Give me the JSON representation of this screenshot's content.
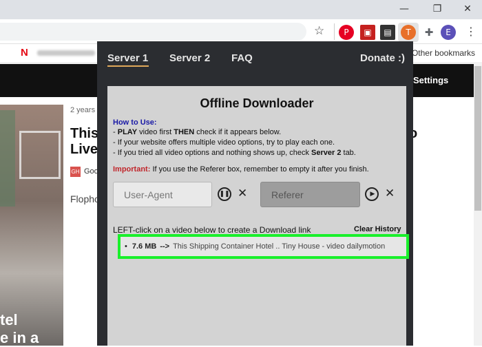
{
  "browser": {
    "window_controls": {
      "minimize": "—",
      "restore": "❐",
      "close": "✕"
    },
    "extensions": [
      {
        "icon": "pinterest-icon",
        "glyph": "P",
        "color": "#e60023"
      },
      {
        "icon": "pdf-icon",
        "glyph": "▣",
        "color": "#c5211f"
      },
      {
        "icon": "screen-capture-icon",
        "glyph": "▤",
        "color": "#333333"
      },
      {
        "icon": "downloader-extension-icon",
        "glyph": "T",
        "color": "#e8702a"
      },
      {
        "icon": "puzzle-icon",
        "glyph": "✚",
        "color": "#5f6368"
      },
      {
        "icon": "profile-avatar",
        "glyph": "E",
        "color": "#5b50b8"
      }
    ],
    "star_glyph": "☆",
    "menu_glyph": "⋮",
    "other_bookmarks": "Other bookmarks"
  },
  "page": {
    "settings": "Settings",
    "date": "2 years a",
    "title_line1": "This",
    "title_line2": "Live",
    "title_end": "o",
    "badge": "GH",
    "badge_text": "Goo",
    "author": "Flopho",
    "photo_text_1": "tel",
    "photo_text_2": "e in a"
  },
  "popup": {
    "tabs": [
      "Server 1",
      "Server 2",
      "FAQ"
    ],
    "donate": "Donate :)",
    "title": "Offline Downloader",
    "how_to": "How to Use:",
    "instructions": [
      {
        "prefix": "- ",
        "b1": "PLAY",
        "t1": " video first ",
        "b2": "THEN",
        "t2": " check if it appears below."
      },
      {
        "prefix": "- If your website offers multiple video options, try to play each one.",
        "b1": "",
        "t1": "",
        "b2": "",
        "t2": ""
      },
      {
        "prefix": "- If you tried all video options and nothing shows up, check ",
        "b1": "Server 2",
        "t1": " tab.",
        "b2": "",
        "t2": ""
      }
    ],
    "important_label": "Important:",
    "important_text": " If you use the Referer box, remember to empty it after you finish.",
    "useragent_placeholder": "User-Agent",
    "referer_placeholder": "Referer",
    "pause_glyph": "❚❚",
    "play_glyph": "▶",
    "close_glyph": "✕",
    "left_click_text": "LEFT-click on a video below to create a Download link",
    "clear_history": "Clear History",
    "video_item": {
      "bullet": "•",
      "size": "7.6 MB",
      "arrow": "-->",
      "title": "This Shipping Container Hotel .. Tiny House - video dailymotion"
    }
  },
  "colors": {
    "highlight": "#19f02b",
    "tab_underline": "#e0a85a",
    "popup_bg": "#2b2d31",
    "panel_bg": "#d3d3d3"
  }
}
